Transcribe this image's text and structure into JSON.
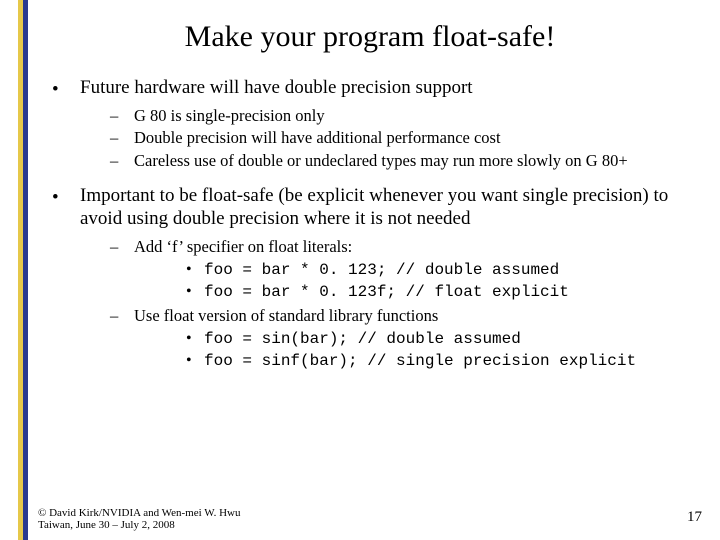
{
  "title": "Make your program float-safe!",
  "bullets": {
    "b0": {
      "text": "Future hardware will have double precision support",
      "sub": [
        "G 80 is single-precision only",
        "Double precision will have additional performance cost",
        "Careless use of double or undeclared types may run more slowly on G 80+"
      ]
    },
    "b1": {
      "text": "Important to be float-safe (be explicit whenever you want single precision) to avoid using double precision where it is not needed",
      "sub0": {
        "text": "Add ‘f’ specifier on float literals:",
        "code": [
          "foo = bar * 0. 123;   // double assumed",
          "foo = bar * 0. 123f;  // float explicit"
        ]
      },
      "sub1": {
        "text": "Use float version of standard library functions",
        "code": [
          "foo = sin(bar);   // double assumed",
          "foo = sinf(bar);  // single precision explicit"
        ]
      }
    }
  },
  "footer": {
    "line1": "© David Kirk/NVIDIA and Wen-mei W. Hwu",
    "line2": "Taiwan, June 30 – July 2, 2008"
  },
  "page_number": "17"
}
